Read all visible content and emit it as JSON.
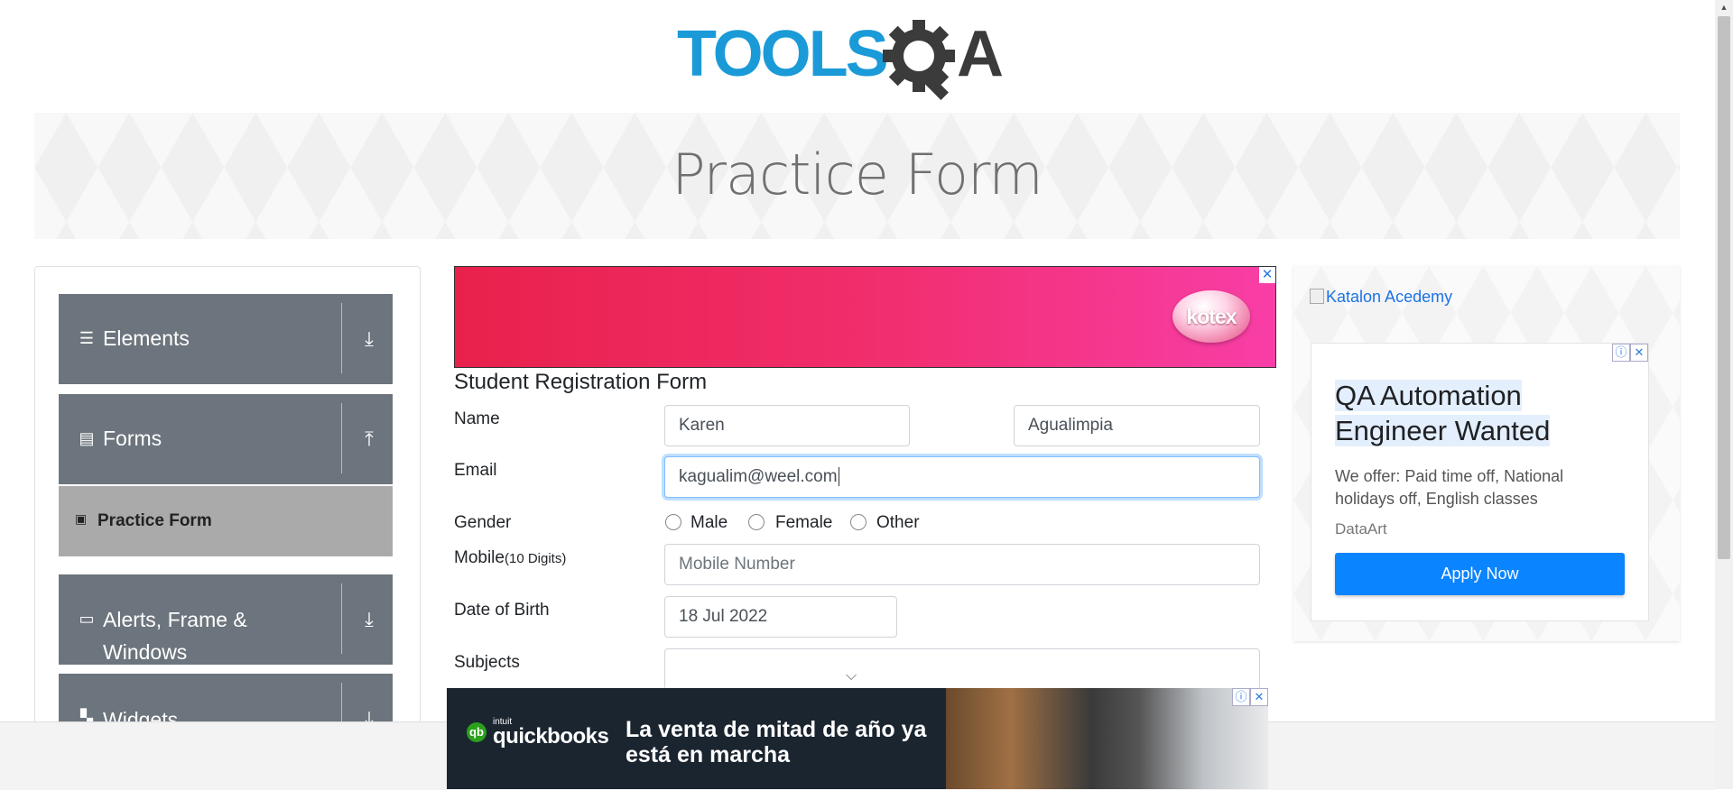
{
  "header": {
    "logo_text": "TOOLSQA",
    "page_title": "Practice Form"
  },
  "sidebar": {
    "groups": [
      {
        "label": "Elements",
        "icon": "hamburger-icon",
        "arrow": "download-arrow-icon"
      },
      {
        "label": "Forms",
        "icon": "document-icon",
        "arrow": "upload-arrow-icon"
      },
      {
        "label": "Alerts, Frame & Windows",
        "icon": "window-icon",
        "arrow": "download-arrow-icon"
      },
      {
        "label": "Widgets",
        "icon": "widgets-icon",
        "arrow": "download-arrow-icon"
      }
    ],
    "active_item": "Practice Form"
  },
  "ads": {
    "top_brand": "kotex",
    "right_alt": "Katalon Acedemy",
    "right_headline": "QA Automation Engineer Wanted",
    "right_desc": "We offer: Paid time off, National holidays off, English classes",
    "right_brand": "DataArt",
    "right_cta": "Apply Now",
    "bottom_intuit": "intuit",
    "bottom_name": "quickbooks",
    "bottom_text": "La venta de mitad de año ya está en marcha"
  },
  "form": {
    "title": "Student Registration Form",
    "name_label": "Name",
    "first_name": "Karen",
    "last_name": "Agualimpia",
    "email_label": "Email",
    "email_value": "kagualim@weel.com",
    "gender_label": "Gender",
    "gender_options": [
      "Male",
      "Female",
      "Other"
    ],
    "mobile_label": "Mobile",
    "mobile_hint": "(10 Digits)",
    "mobile_placeholder": "Mobile Number",
    "dob_label": "Date of Birth",
    "dob_value": "18 Jul 2022",
    "subjects_label": "Subjects"
  },
  "colors": {
    "sidebar_group": "#6c757d",
    "active_item": "#aaaaaa",
    "cta": "#0a84ff",
    "logo_blue": "#1b9ad8",
    "logo_gray": "#3b3b3b"
  }
}
